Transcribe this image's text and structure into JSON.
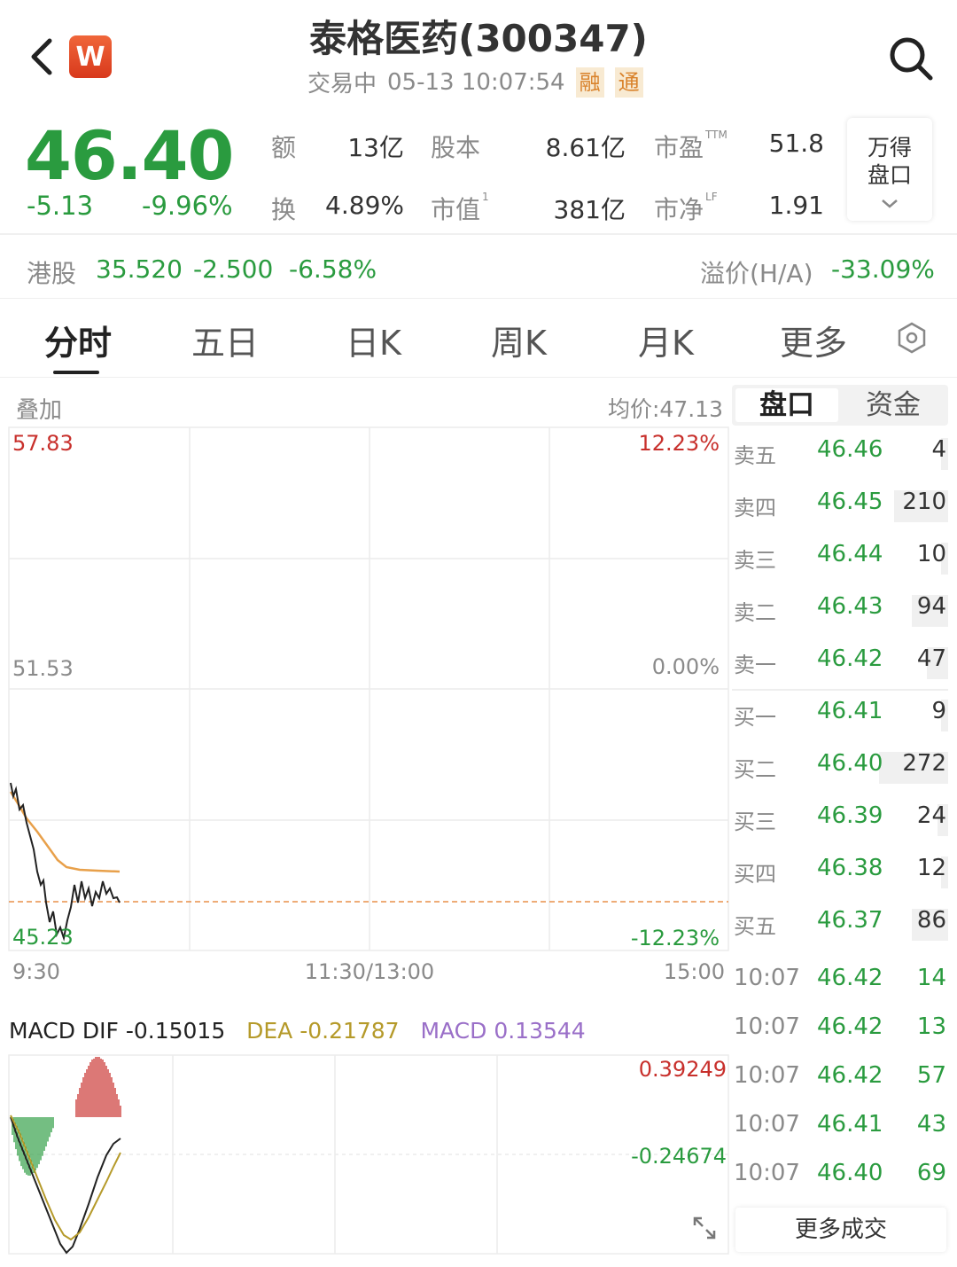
{
  "header": {
    "title": "泰格医药(300347)",
    "status": "交易中",
    "datetime": "05-13 10:07:54",
    "tags": [
      "融",
      "通"
    ],
    "badge": "W"
  },
  "quote": {
    "price": "46.40",
    "change": "-5.13",
    "change_pct": "-9.96%",
    "fields": [
      {
        "label": "额",
        "value": "13亿"
      },
      {
        "label": "股本",
        "value": "8.61亿"
      },
      {
        "label": "市盈",
        "sup": "TTM",
        "value": "51.8"
      },
      {
        "label": "换",
        "value": "4.89%"
      },
      {
        "label": "市值",
        "sup": "1",
        "value": "381亿"
      },
      {
        "label": "市净",
        "sup": "LF",
        "value": "1.91"
      }
    ],
    "wande_line1": "万得",
    "wande_line2": "盘口"
  },
  "hk": {
    "label": "港股",
    "price": "35.520",
    "change": "-2.500",
    "change_pct": "-6.58%",
    "premium_label": "溢价(H/A)",
    "premium": "-33.09%"
  },
  "tabs": [
    "分时",
    "五日",
    "日K",
    "周K",
    "月K",
    "更多"
  ],
  "chart": {
    "overlay_label": "叠加",
    "avg_label": "均价:47.13",
    "y_top": "57.83",
    "y_mid": "51.53",
    "y_bottom": "45.23",
    "pct_top": "12.23%",
    "pct_mid": "0.00%",
    "pct_bottom": "-12.23%",
    "x_start": "9:30",
    "x_mid": "11:30/13:00",
    "x_end": "15:00"
  },
  "macd": {
    "dif": "MACD DIF -0.15015",
    "dea": "DEA -0.21787",
    "macd": "MACD 0.13544",
    "top": "0.39249",
    "mid": "-0.24674"
  },
  "book": {
    "tab_active": "盘口",
    "tab_other": "资金",
    "asks": [
      {
        "label": "卖五",
        "price": "46.46",
        "vol": "4",
        "bar": 0.01
      },
      {
        "label": "卖四",
        "price": "46.45",
        "vol": "210",
        "bar": 0.25
      },
      {
        "label": "卖三",
        "price": "46.44",
        "vol": "10",
        "bar": 0.02
      },
      {
        "label": "卖二",
        "price": "46.43",
        "vol": "94",
        "bar": 0.17
      },
      {
        "label": "卖一",
        "price": "46.42",
        "vol": "47",
        "bar": 0.1
      }
    ],
    "bids": [
      {
        "label": "买一",
        "price": "46.41",
        "vol": "9",
        "bar": 0.02
      },
      {
        "label": "买二",
        "price": "46.40",
        "vol": "272",
        "bar": 0.32
      },
      {
        "label": "买三",
        "price": "46.39",
        "vol": "24",
        "bar": 0.05
      },
      {
        "label": "买四",
        "price": "46.38",
        "vol": "12",
        "bar": 0.03
      },
      {
        "label": "买五",
        "price": "46.37",
        "vol": "86",
        "bar": 0.17
      }
    ],
    "trades": [
      {
        "time": "10:07",
        "price": "46.42",
        "vol": "14"
      },
      {
        "time": "10:07",
        "price": "46.42",
        "vol": "13"
      },
      {
        "time": "10:07",
        "price": "46.42",
        "vol": "57"
      },
      {
        "time": "10:07",
        "price": "46.41",
        "vol": "43"
      },
      {
        "time": "10:07",
        "price": "46.40",
        "vol": "69"
      }
    ],
    "more_label": "更多成交"
  },
  "colors": {
    "up": "#c8302c",
    "down": "#2a9b3f",
    "avg": "#e8a04a",
    "dea": "#b59a2a",
    "macd": "#9a6fc8"
  }
}
